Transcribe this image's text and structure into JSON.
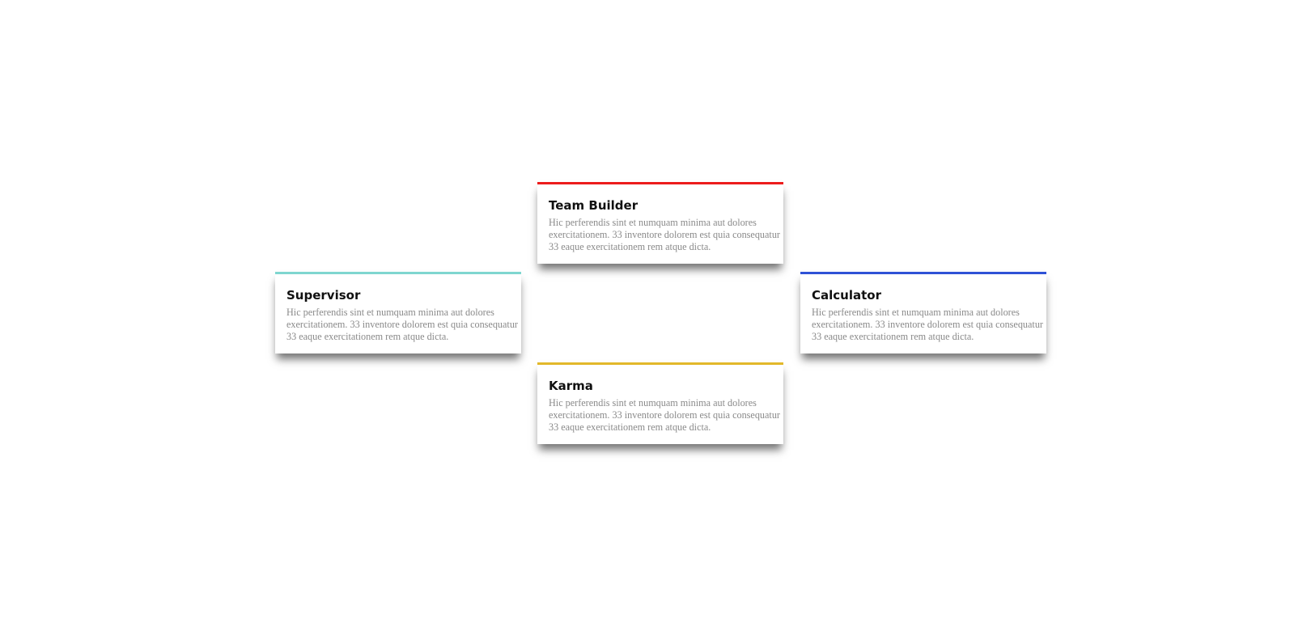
{
  "cards": [
    {
      "title": "Team Builder",
      "text_lines": [
        "Hic perferendis sint et numquam minima aut dolores",
        "exercitationem. 33 inventore dolorem est quia consequatur",
        "33 eaque exercitationem rem atque dicta."
      ],
      "accent_color": "#ec1c1c"
    },
    {
      "title": "Supervisor",
      "text_lines": [
        "Hic perferendis sint et numquam minima aut dolores",
        "exercitationem. 33 inventore dolorem est quia consequatur",
        "33 eaque exercitationem rem atque dicta."
      ],
      "accent_color": "#7fd6d0"
    },
    {
      "title": "Calculator",
      "text_lines": [
        "Hic perferendis sint et numquam minima aut dolores",
        "exercitationem. 33 inventore dolorem est quia consequatur",
        "33 eaque exercitationem rem atque dicta."
      ],
      "accent_color": "#2f52d6"
    },
    {
      "title": "Karma",
      "text_lines": [
        "Hic perferendis sint et numquam minima aut dolores",
        "exercitationem. 33 inventore dolorem est quia consequatur",
        "33 eaque exercitationem rem atque dicta."
      ],
      "accent_color": "#e2b82a"
    }
  ]
}
